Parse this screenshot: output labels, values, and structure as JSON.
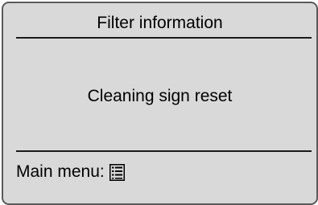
{
  "screen": {
    "title": "Filter information",
    "message": "Cleaning sign reset",
    "footer": {
      "label": "Main menu:",
      "icon": "main-menu-list-icon"
    }
  },
  "colors": {
    "background": "#d9d9d9",
    "border": "#5a5a5a",
    "text": "#000000"
  }
}
